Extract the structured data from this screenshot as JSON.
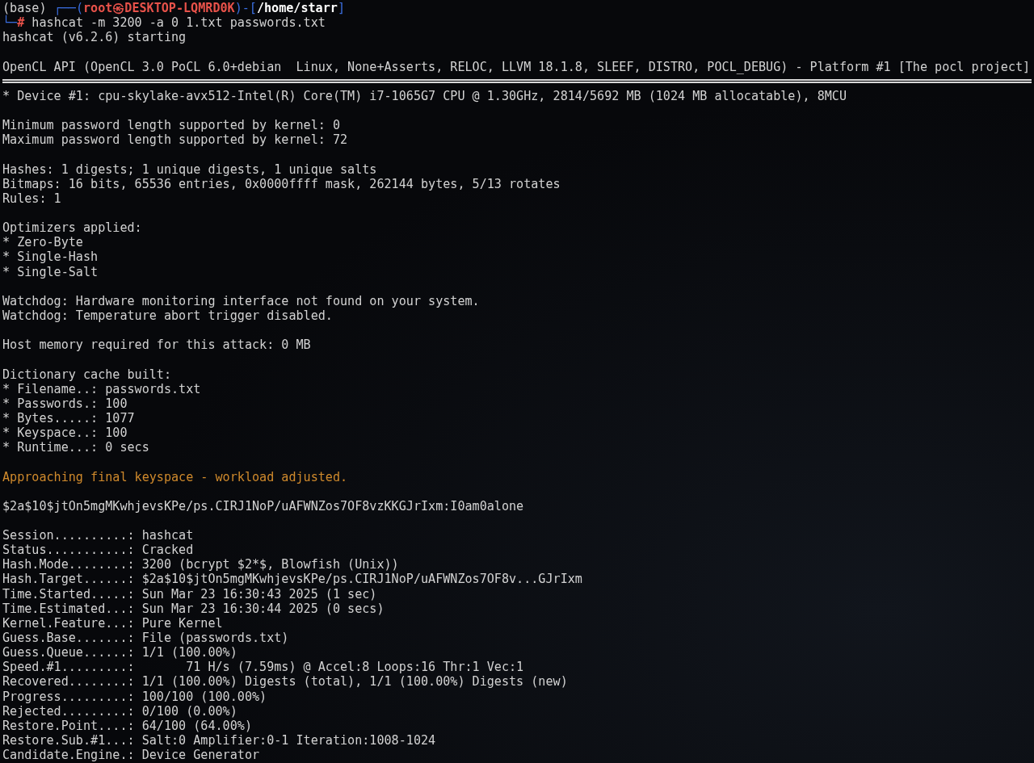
{
  "terminal": {
    "lines": [
      {
        "kind": "segments",
        "segments": [
          {
            "kind": "plain",
            "text": "(base) "
          },
          {
            "kind": "frame",
            "text": "┌──("
          },
          {
            "kind": "user",
            "text": "root㉿DESKTOP-LQMRD0K"
          },
          {
            "kind": "frame",
            "text": ")-["
          },
          {
            "kind": "path",
            "text": "/home/starr"
          },
          {
            "kind": "frame",
            "text": "]"
          }
        ]
      },
      {
        "kind": "segments",
        "segments": [
          {
            "kind": "frame",
            "text": "└─"
          },
          {
            "kind": "user",
            "text": "#"
          },
          {
            "kind": "plain",
            "text": " hashcat -m 3200 -a 0 1.txt passwords.txt"
          }
        ]
      },
      {
        "kind": "text",
        "text": "hashcat (v6.2.6) starting"
      },
      {
        "kind": "blank"
      },
      {
        "kind": "text",
        "text": "OpenCL API (OpenCL 3.0 PoCL 6.0+debian  Linux, None+Asserts, RELOC, LLVM 18.1.8, SLEEF, DISTRO, POCL_DEBUG) - Platform #1 [The pocl project]"
      },
      {
        "kind": "separator"
      },
      {
        "kind": "text",
        "text": "* Device #1: cpu-skylake-avx512-Intel(R) Core(TM) i7-1065G7 CPU @ 1.30GHz, 2814/5692 MB (1024 MB allocatable), 8MCU"
      },
      {
        "kind": "blank"
      },
      {
        "kind": "text",
        "text": "Minimum password length supported by kernel: 0"
      },
      {
        "kind": "text",
        "text": "Maximum password length supported by kernel: 72"
      },
      {
        "kind": "blank"
      },
      {
        "kind": "text",
        "text": "Hashes: 1 digests; 1 unique digests, 1 unique salts"
      },
      {
        "kind": "text",
        "text": "Bitmaps: 16 bits, 65536 entries, 0x0000ffff mask, 262144 bytes, 5/13 rotates"
      },
      {
        "kind": "text",
        "text": "Rules: 1"
      },
      {
        "kind": "blank"
      },
      {
        "kind": "text",
        "text": "Optimizers applied:"
      },
      {
        "kind": "text",
        "text": "* Zero-Byte"
      },
      {
        "kind": "text",
        "text": "* Single-Hash"
      },
      {
        "kind": "text",
        "text": "* Single-Salt"
      },
      {
        "kind": "blank"
      },
      {
        "kind": "text",
        "text": "Watchdog: Hardware monitoring interface not found on your system."
      },
      {
        "kind": "text",
        "text": "Watchdog: Temperature abort trigger disabled."
      },
      {
        "kind": "blank"
      },
      {
        "kind": "text",
        "text": "Host memory required for this attack: 0 MB"
      },
      {
        "kind": "blank"
      },
      {
        "kind": "text",
        "text": "Dictionary cache built:"
      },
      {
        "kind": "text",
        "text": "* Filename..: passwords.txt"
      },
      {
        "kind": "text",
        "text": "* Passwords.: 100"
      },
      {
        "kind": "text",
        "text": "* Bytes.....: 1077"
      },
      {
        "kind": "text",
        "text": "* Keyspace..: 100"
      },
      {
        "kind": "text",
        "text": "* Runtime...: 0 secs"
      },
      {
        "kind": "blank"
      },
      {
        "kind": "warning",
        "text": "Approaching final keyspace - workload adjusted."
      },
      {
        "kind": "blank"
      },
      {
        "kind": "text",
        "text": "$2a$10$jtOn5mgMKwhjevsKPe/ps.CIRJ1NoP/uAFWNZos7OF8vzKKGJrIxm:I0am0alone"
      },
      {
        "kind": "blank"
      },
      {
        "kind": "text",
        "text": "Session..........: hashcat"
      },
      {
        "kind": "text",
        "text": "Status...........: Cracked"
      },
      {
        "kind": "text",
        "text": "Hash.Mode........: 3200 (bcrypt $2*$, Blowfish (Unix))"
      },
      {
        "kind": "text",
        "text": "Hash.Target......: $2a$10$jtOn5mgMKwhjevsKPe/ps.CIRJ1NoP/uAFWNZos7OF8v...GJrIxm"
      },
      {
        "kind": "text",
        "text": "Time.Started.....: Sun Mar 23 16:30:43 2025 (1 sec)"
      },
      {
        "kind": "text",
        "text": "Time.Estimated...: Sun Mar 23 16:30:44 2025 (0 secs)"
      },
      {
        "kind": "text",
        "text": "Kernel.Feature...: Pure Kernel"
      },
      {
        "kind": "text",
        "text": "Guess.Base.......: File (passwords.txt)"
      },
      {
        "kind": "text",
        "text": "Guess.Queue......: 1/1 (100.00%)"
      },
      {
        "kind": "text",
        "text": "Speed.#1.........:       71 H/s (7.59ms) @ Accel:8 Loops:16 Thr:1 Vec:1"
      },
      {
        "kind": "text",
        "text": "Recovered........: 1/1 (100.00%) Digests (total), 1/1 (100.00%) Digests (new)"
      },
      {
        "kind": "text",
        "text": "Progress.........: 100/100 (100.00%)"
      },
      {
        "kind": "text",
        "text": "Rejected.........: 0/100 (0.00%)"
      },
      {
        "kind": "text",
        "text": "Restore.Point....: 64/100 (64.00%)"
      },
      {
        "kind": "text",
        "text": "Restore.Sub.#1...: Salt:0 Amplifier:0-1 Iteration:1008-1024"
      },
      {
        "kind": "text",
        "text": "Candidate.Engine.: Device Generator"
      }
    ]
  }
}
